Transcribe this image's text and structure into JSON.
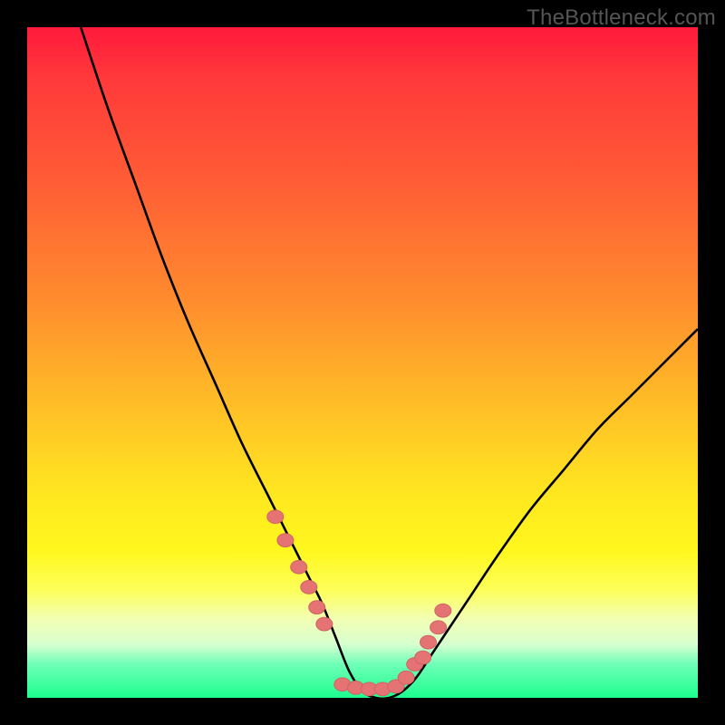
{
  "watermark": "TheBottleneck.com",
  "colors": {
    "frame": "#000000",
    "gradient_top": "#ff1a3c",
    "gradient_bottom": "#1cff8f",
    "curve": "#000000",
    "marker_fill": "#e57373",
    "marker_stroke": "#d06363"
  },
  "chart_data": {
    "type": "line",
    "title": "",
    "xlabel": "",
    "ylabel": "",
    "xlim": [
      0,
      100
    ],
    "ylim": [
      0,
      100
    ],
    "grid": false,
    "legend": false,
    "note": "Bottleneck-style curve. x in [0,100] approximates normalized balance position; y in [0,100] approximates bottleneck severity (0 = balanced/green, 100 = severe/red). Curve visually minimizes ~x=48–55 at y≈0, left branch reaches y≈100 near x≈8, right branch reaches y≈55 near x=100.",
    "series": [
      {
        "name": "bottleneck-curve",
        "x": [
          8,
          12,
          16,
          20,
          24,
          28,
          32,
          36,
          38,
          40,
          42,
          44,
          46,
          48,
          50,
          52,
          54,
          56,
          58,
          60,
          62,
          66,
          70,
          75,
          80,
          85,
          90,
          95,
          100
        ],
        "y": [
          100,
          88,
          77,
          66,
          56,
          47,
          38,
          30,
          26,
          22,
          18,
          14,
          9,
          4,
          1,
          0,
          0,
          1,
          3,
          6,
          9,
          15,
          21,
          28,
          34,
          40,
          45,
          50,
          55
        ]
      }
    ],
    "markers": {
      "name": "highlight-dots",
      "note": "Salmon dots clustered near the valley on both branches plus the flat bottom.",
      "x": [
        37.0,
        38.5,
        40.5,
        42.0,
        43.2,
        44.3,
        47.0,
        49.0,
        51.0,
        53.0,
        55.0,
        56.5,
        57.8,
        59.0,
        59.8,
        61.3,
        62.0
      ],
      "y": [
        27.0,
        23.5,
        19.5,
        16.5,
        13.5,
        11.0,
        2.0,
        1.5,
        1.3,
        1.3,
        1.7,
        3.0,
        5.0,
        6.0,
        8.3,
        10.5,
        13.0
      ]
    }
  }
}
